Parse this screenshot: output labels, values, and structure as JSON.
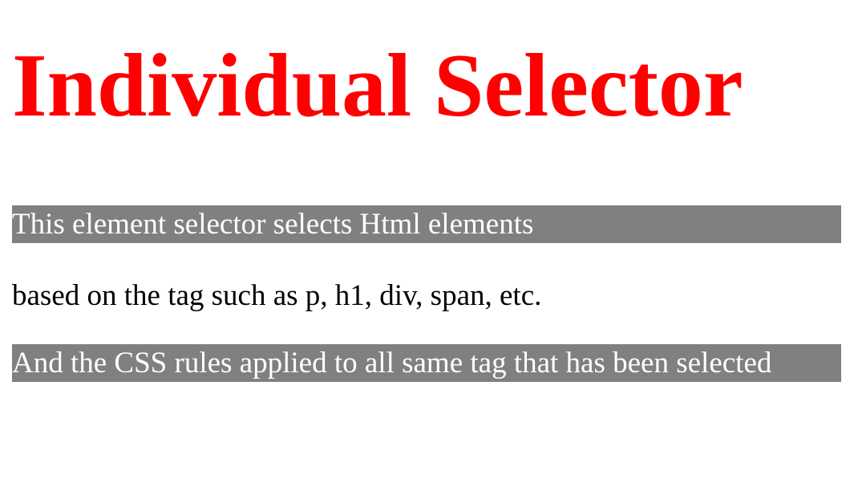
{
  "heading": "Individual Selector",
  "paragraphs": [
    "This element selector selects Html elements",
    "based on the tag such as p, h1, div, span, etc.",
    "And the CSS rules applied to all same tag that has been selected"
  ],
  "colors": {
    "heading": "#ff0000",
    "highlight_bg": "#808080",
    "highlight_text": "#ffffff",
    "body_text": "#000000",
    "page_bg": "#ffffff"
  }
}
